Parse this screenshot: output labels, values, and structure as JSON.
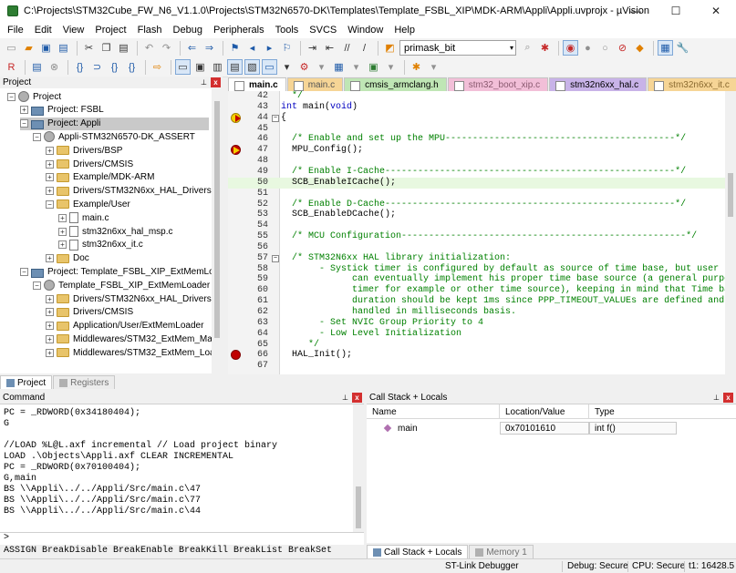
{
  "window": {
    "title": "C:\\Projects\\STM32Cube_FW_N6_V1.1.0\\Projects\\STM32N6570-DK\\Templates\\Template_FSBL_XIP\\MDK-ARM\\Appli\\Appli.uvprojx - µVision",
    "minimize": "—",
    "maximize": "☐",
    "close": "✕"
  },
  "menu": [
    "File",
    "Edit",
    "View",
    "Project",
    "Flash",
    "Debug",
    "Peripherals",
    "Tools",
    "SVCS",
    "Window",
    "Help"
  ],
  "toolbar": {
    "combo_value": "primask_bit",
    "combo_arrow": "▾"
  },
  "project_panel": {
    "title": "Project",
    "pin": "⊥",
    "close": "x",
    "tree": [
      {
        "label": "Project",
        "level": 0,
        "expander": "−",
        "icon": "gear"
      },
      {
        "label": "Project: FSBL",
        "level": 1,
        "expander": "+",
        "icon": "proj"
      },
      {
        "label": "Project: Appli",
        "level": 1,
        "expander": "−",
        "icon": "proj",
        "selected": true
      },
      {
        "label": "Appli-STM32N6570-DK_ASSERT",
        "level": 2,
        "expander": "−",
        "icon": "gear"
      },
      {
        "label": "Drivers/BSP",
        "level": 3,
        "expander": "+",
        "icon": "folder"
      },
      {
        "label": "Drivers/CMSIS",
        "level": 3,
        "expander": "+",
        "icon": "folder"
      },
      {
        "label": "Example/MDK-ARM",
        "level": 3,
        "expander": "+",
        "icon": "folder"
      },
      {
        "label": "Drivers/STM32N6xx_HAL_Drivers",
        "level": 3,
        "expander": "+",
        "icon": "folder"
      },
      {
        "label": "Example/User",
        "level": 3,
        "expander": "−",
        "icon": "folder"
      },
      {
        "label": "main.c",
        "level": 4,
        "expander": "+",
        "icon": "file"
      },
      {
        "label": "stm32n6xx_hal_msp.c",
        "level": 4,
        "expander": "+",
        "icon": "file"
      },
      {
        "label": "stm32n6xx_it.c",
        "level": 4,
        "expander": "+",
        "icon": "file"
      },
      {
        "label": "Doc",
        "level": 3,
        "expander": "+",
        "icon": "folder"
      },
      {
        "label": "Project: Template_FSBL_XIP_ExtMemLoader",
        "level": 1,
        "expander": "−",
        "icon": "proj"
      },
      {
        "label": "Template_FSBL_XIP_ExtMemLoader",
        "level": 2,
        "expander": "−",
        "icon": "gear"
      },
      {
        "label": "Drivers/STM32N6xx_HAL_Drivers",
        "level": 3,
        "expander": "+",
        "icon": "folder"
      },
      {
        "label": "Drivers/CMSIS",
        "level": 3,
        "expander": "+",
        "icon": "folder"
      },
      {
        "label": "Application/User/ExtMemLoader",
        "level": 3,
        "expander": "+",
        "icon": "folder"
      },
      {
        "label": "Middlewares/STM32_ExtMem_Manage",
        "level": 3,
        "expander": "+",
        "icon": "folder"
      },
      {
        "label": "Middlewares/STM32_ExtMem_Loader",
        "level": 3,
        "expander": "+",
        "icon": "folder"
      }
    ],
    "tabs": [
      "Project",
      "Registers"
    ]
  },
  "editor": {
    "tabs": [
      "main.c",
      "main.c",
      "cmsis_armclang.h",
      "stm32_boot_xip.c",
      "stm32n6xx_hal.c",
      "stm32n6xx_it.c"
    ],
    "lines": [
      {
        "n": "42",
        "text": "  */",
        "cls": "cmt"
      },
      {
        "n": "43",
        "text": "int main(void)",
        "cls": "kwline"
      },
      {
        "n": "44",
        "text": "{",
        "fold": "−",
        "marker": "pc"
      },
      {
        "n": "45",
        "text": ""
      },
      {
        "n": "46",
        "text": "  /* Enable and set up the MPU------------------------------------------*/",
        "cls": "cmt"
      },
      {
        "n": "47",
        "text": "  MPU_Config();",
        "marker": "cur"
      },
      {
        "n": "48",
        "text": ""
      },
      {
        "n": "49",
        "text": "  /* Enable I-Cache-----------------------------------------------------*/",
        "cls": "cmt"
      },
      {
        "n": "50",
        "text": "  SCB_EnableICache();",
        "hl": true
      },
      {
        "n": "51",
        "text": ""
      },
      {
        "n": "52",
        "text": "  /* Enable D-Cache-----------------------------------------------------*/",
        "cls": "cmt"
      },
      {
        "n": "53",
        "text": "  SCB_EnableDCache();"
      },
      {
        "n": "54",
        "text": ""
      },
      {
        "n": "55",
        "text": "  /* MCU Configuration----------------------------------------------------*/",
        "cls": "cmt"
      },
      {
        "n": "56",
        "text": ""
      },
      {
        "n": "57",
        "text": "  /* STM32N6xx HAL library initialization:",
        "cls": "cmt",
        "fold": "−"
      },
      {
        "n": "58",
        "text": "       - Systick timer is configured by default as source of time base, but user",
        "cls": "cmt"
      },
      {
        "n": "59",
        "text": "             can eventually implement his proper time base source (a general purpo",
        "cls": "cmt"
      },
      {
        "n": "60",
        "text": "             timer for example or other time source), keeping in mind that Time ba",
        "cls": "cmt"
      },
      {
        "n": "61",
        "text": "             duration should be kept 1ms since PPP_TIMEOUT_VALUEs are defined and",
        "cls": "cmt"
      },
      {
        "n": "62",
        "text": "             handled in milliseconds basis.",
        "cls": "cmt"
      },
      {
        "n": "63",
        "text": "       - Set NVIC Group Priority to 4",
        "cls": "cmt"
      },
      {
        "n": "64",
        "text": "       - Low Level Initialization",
        "cls": "cmt"
      },
      {
        "n": "65",
        "text": "     */",
        "cls": "cmt"
      },
      {
        "n": "66",
        "text": "  HAL_Init();",
        "marker": "bp"
      },
      {
        "n": "67",
        "text": ""
      }
    ]
  },
  "command": {
    "title": "Command",
    "pin": "⊥",
    "close": "x",
    "lines": [
      "PC = _RDWORD(0x34180404);",
      "G",
      "",
      "//LOAD %L@L.axf incremental // Load project binary",
      "LOAD .\\Objects\\Appli.axf CLEAR INCREMENTAL",
      "PC = _RDWORD(0x70100404);",
      "G,main",
      "BS \\\\Appli\\../../Appli/Src/main.c\\47",
      "BS \\\\Appli\\../../Appli/Src/main.c\\77",
      "BS \\\\Appli\\../../Appli/Src/main.c\\44"
    ],
    "prompt": ">",
    "hint": "ASSIGN BreakDisable BreakEnable BreakKill BreakList BreakSet"
  },
  "callstack": {
    "title": "Call Stack + Locals",
    "pin": "⊥",
    "close": "x",
    "columns": [
      "Name",
      "Location/Value",
      "Type"
    ],
    "rows": [
      {
        "name": "main",
        "location": "0x70101610",
        "type": "int f()"
      }
    ],
    "tabs": [
      "Call Stack + Locals",
      "Memory 1"
    ]
  },
  "status": {
    "debugger": "ST-Link Debugger",
    "debug": "Debug: Secure",
    "cpu": "CPU: Secure",
    "time": "t1: 16428.5"
  },
  "colors": {
    "selection": "#c9c9c9",
    "comment": "#008000",
    "keyword": "#0000c0",
    "breakpoint": "#c00000"
  }
}
